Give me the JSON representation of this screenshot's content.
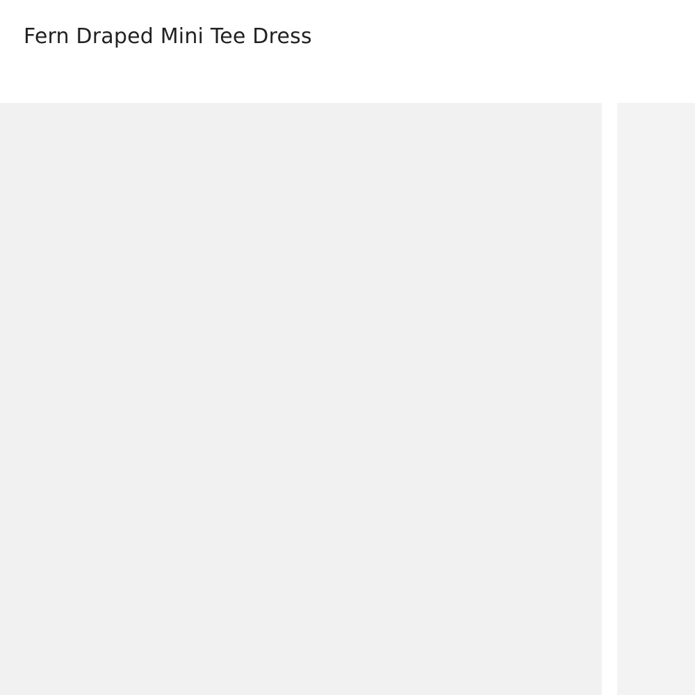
{
  "product": {
    "title": "Fern Draped Mini Tee Dress"
  },
  "gallery": {
    "images": [
      {
        "placeholder": ""
      },
      {
        "placeholder": ""
      }
    ]
  },
  "colors": {
    "background": "#ffffff",
    "title_text": "#222222",
    "image_placeholder": "#f1f1f1"
  }
}
